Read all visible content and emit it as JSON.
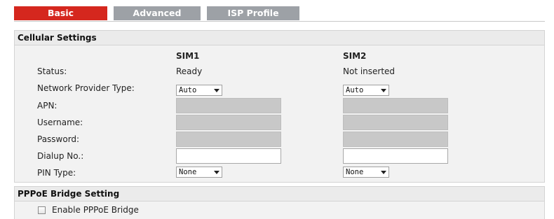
{
  "tabs": [
    {
      "label": "Basic",
      "active": true
    },
    {
      "label": "Advanced",
      "active": false
    },
    {
      "label": "ISP Profile",
      "active": false
    }
  ],
  "cellular": {
    "title": "Cellular Settings",
    "sim1_header": "SIM1",
    "sim2_header": "SIM2",
    "labels": {
      "status": "Status:",
      "provider_type": "Network Provider Type:",
      "apn": "APN:",
      "username": "Username:",
      "password": "Password:",
      "dialup": "Dialup No.:",
      "pin_type": "PIN Type:"
    },
    "sim1": {
      "status": "Ready",
      "provider_type": "Auto",
      "apn": "",
      "username": "",
      "password": "",
      "dialup": "",
      "pin_type": "None"
    },
    "sim2": {
      "status": "Not inserted",
      "provider_type": "Auto",
      "apn": "",
      "username": "",
      "password": "",
      "dialup": "",
      "pin_type": "None"
    }
  },
  "pppoe": {
    "title": "PPPoE Bridge Setting",
    "enable_label": "Enable PPPoE Bridge",
    "enabled": false
  },
  "colors": {
    "active_tab": "#d5271e",
    "inactive_tab": "#9da1a6",
    "disabled_field": "#c8c8c8",
    "section_bg": "#f2f2f2"
  }
}
